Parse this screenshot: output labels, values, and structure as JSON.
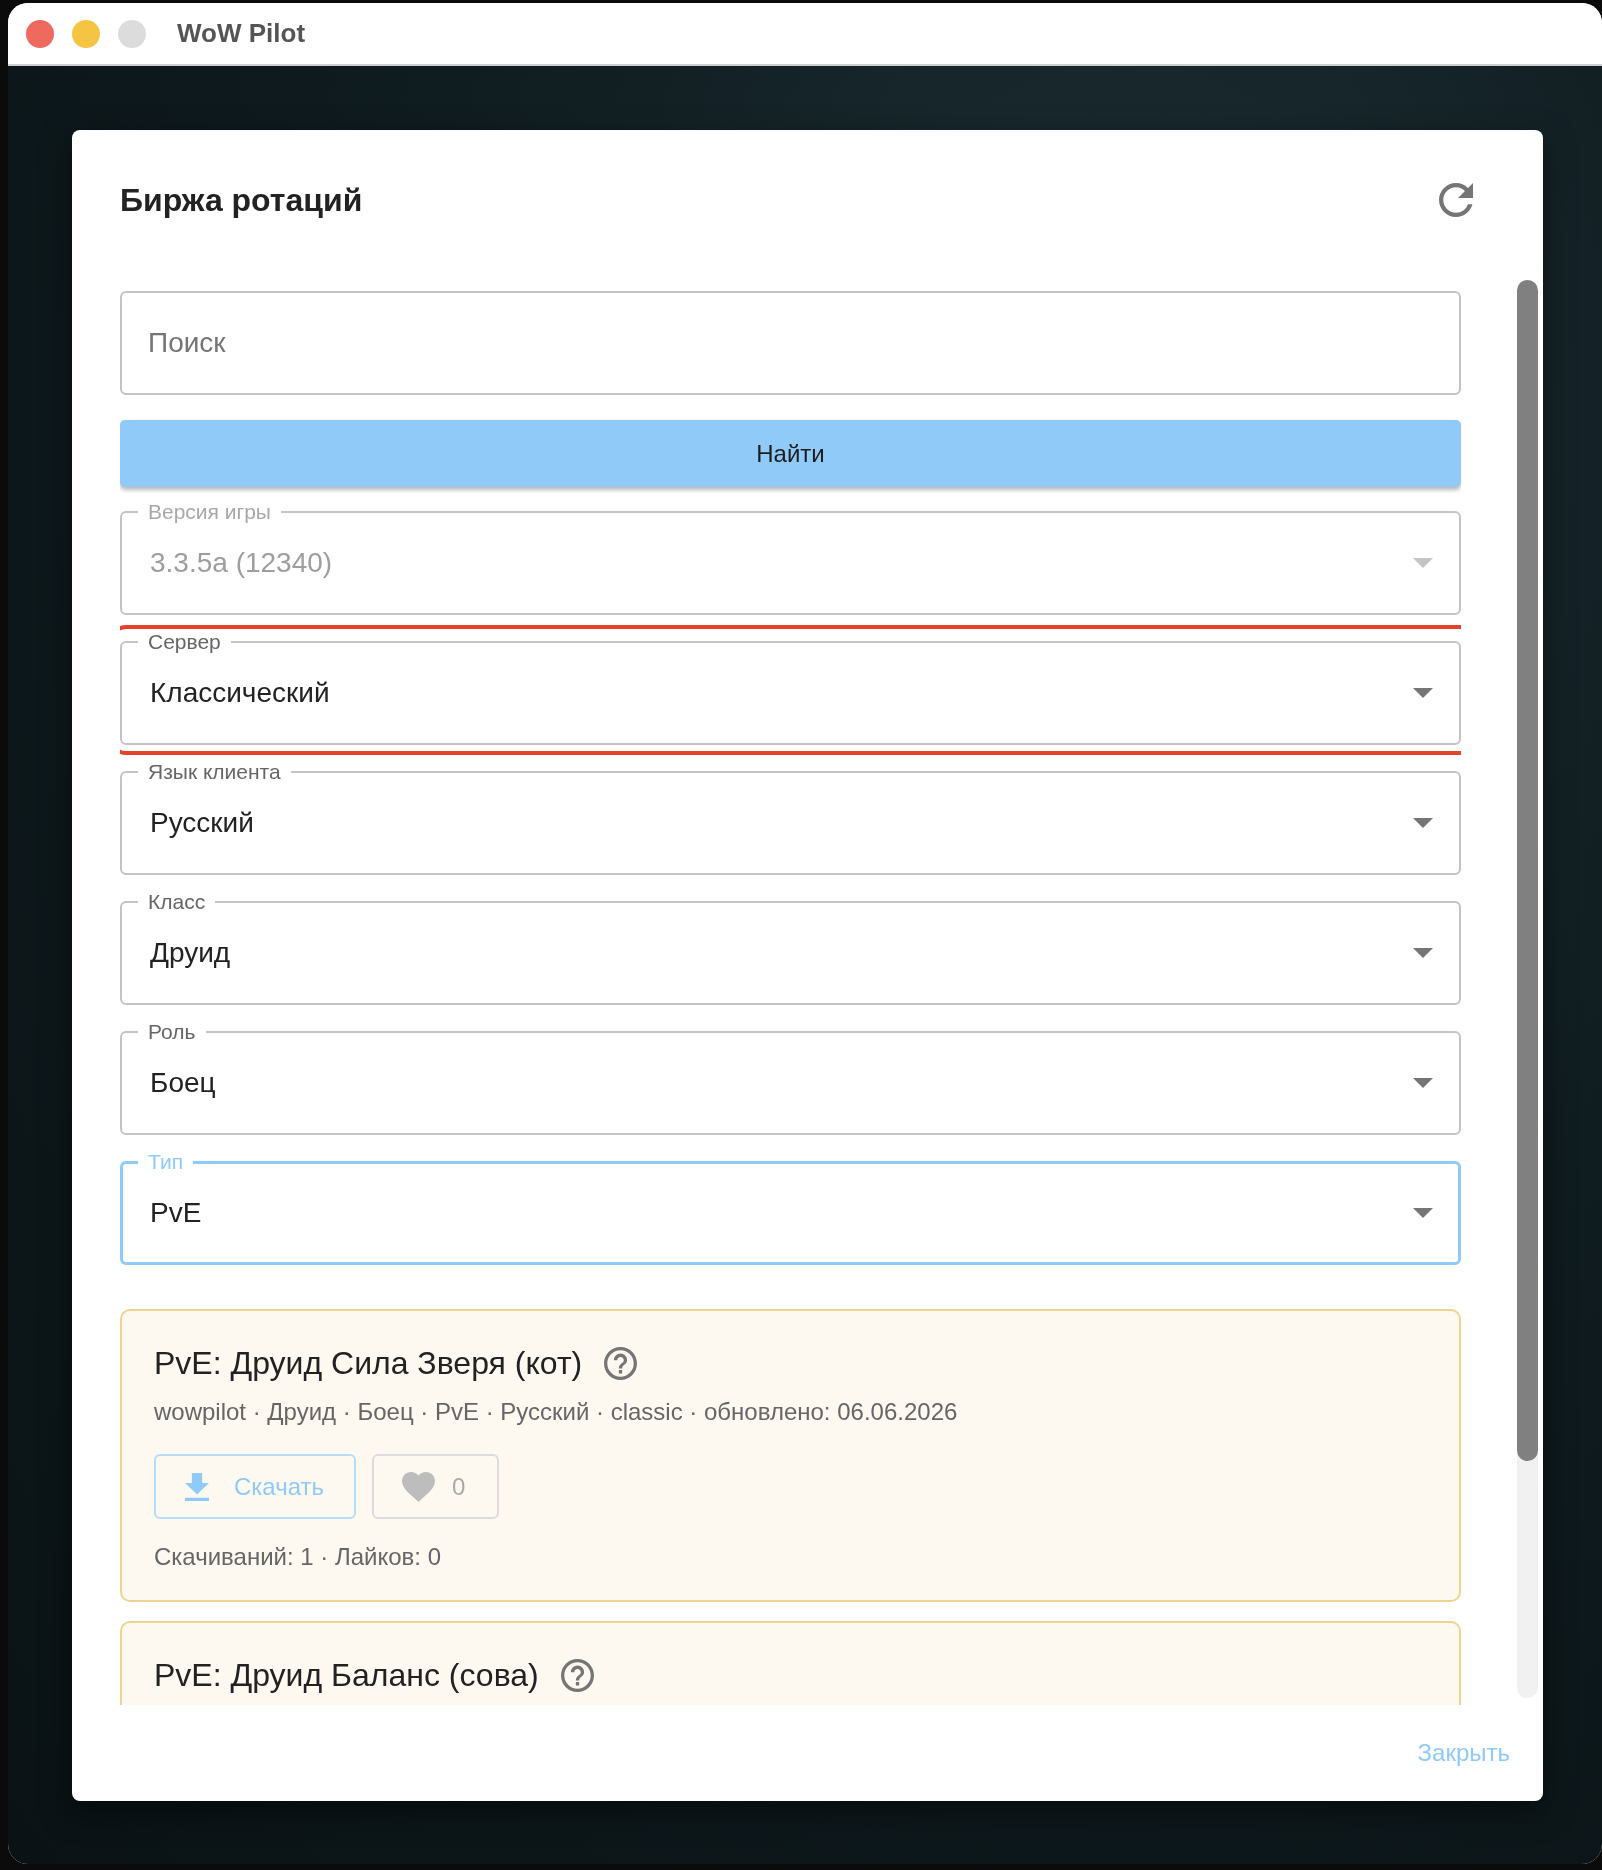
{
  "window": {
    "title": "WoW Pilot",
    "controls": [
      {
        "kind": "close",
        "disabled": false
      },
      {
        "kind": "minimize",
        "disabled": false
      },
      {
        "kind": "zoom",
        "disabled": true
      }
    ]
  },
  "dialog": {
    "title": "Биржа ротаций",
    "search": {
      "placeholder": "Поиск"
    },
    "search_button": "Найти",
    "filters": [
      {
        "label": "Версия игры",
        "value": "3.3.5a (12340)",
        "disabled": true,
        "focused": false,
        "highlighted": false
      },
      {
        "label": "Сервер",
        "value": "Классический",
        "disabled": false,
        "focused": false,
        "highlighted": true
      },
      {
        "label": "Язык клиента",
        "value": "Русский",
        "disabled": false,
        "focused": false,
        "highlighted": false
      },
      {
        "label": "Класс",
        "value": "Друид",
        "disabled": false,
        "focused": false,
        "highlighted": false
      },
      {
        "label": "Роль",
        "value": "Боец",
        "disabled": false,
        "focused": false,
        "highlighted": false
      },
      {
        "label": "Тип",
        "value": "PvE",
        "disabled": false,
        "focused": true,
        "highlighted": false
      }
    ],
    "rotations": [
      {
        "title": "PvE: Друид Сила Зверя (кот)",
        "meta": "wowpilot · Друид · Боец · PvE · Русский · classic · обновлено: 06.06.2026",
        "download_button": "Скачать",
        "likes": "0",
        "liked": false,
        "stats": "Скачиваний: 1 · Лайков: 0"
      },
      {
        "title": "PvE: Друид Баланс (сова)"
      }
    ],
    "close_button": "Закрыть"
  }
}
